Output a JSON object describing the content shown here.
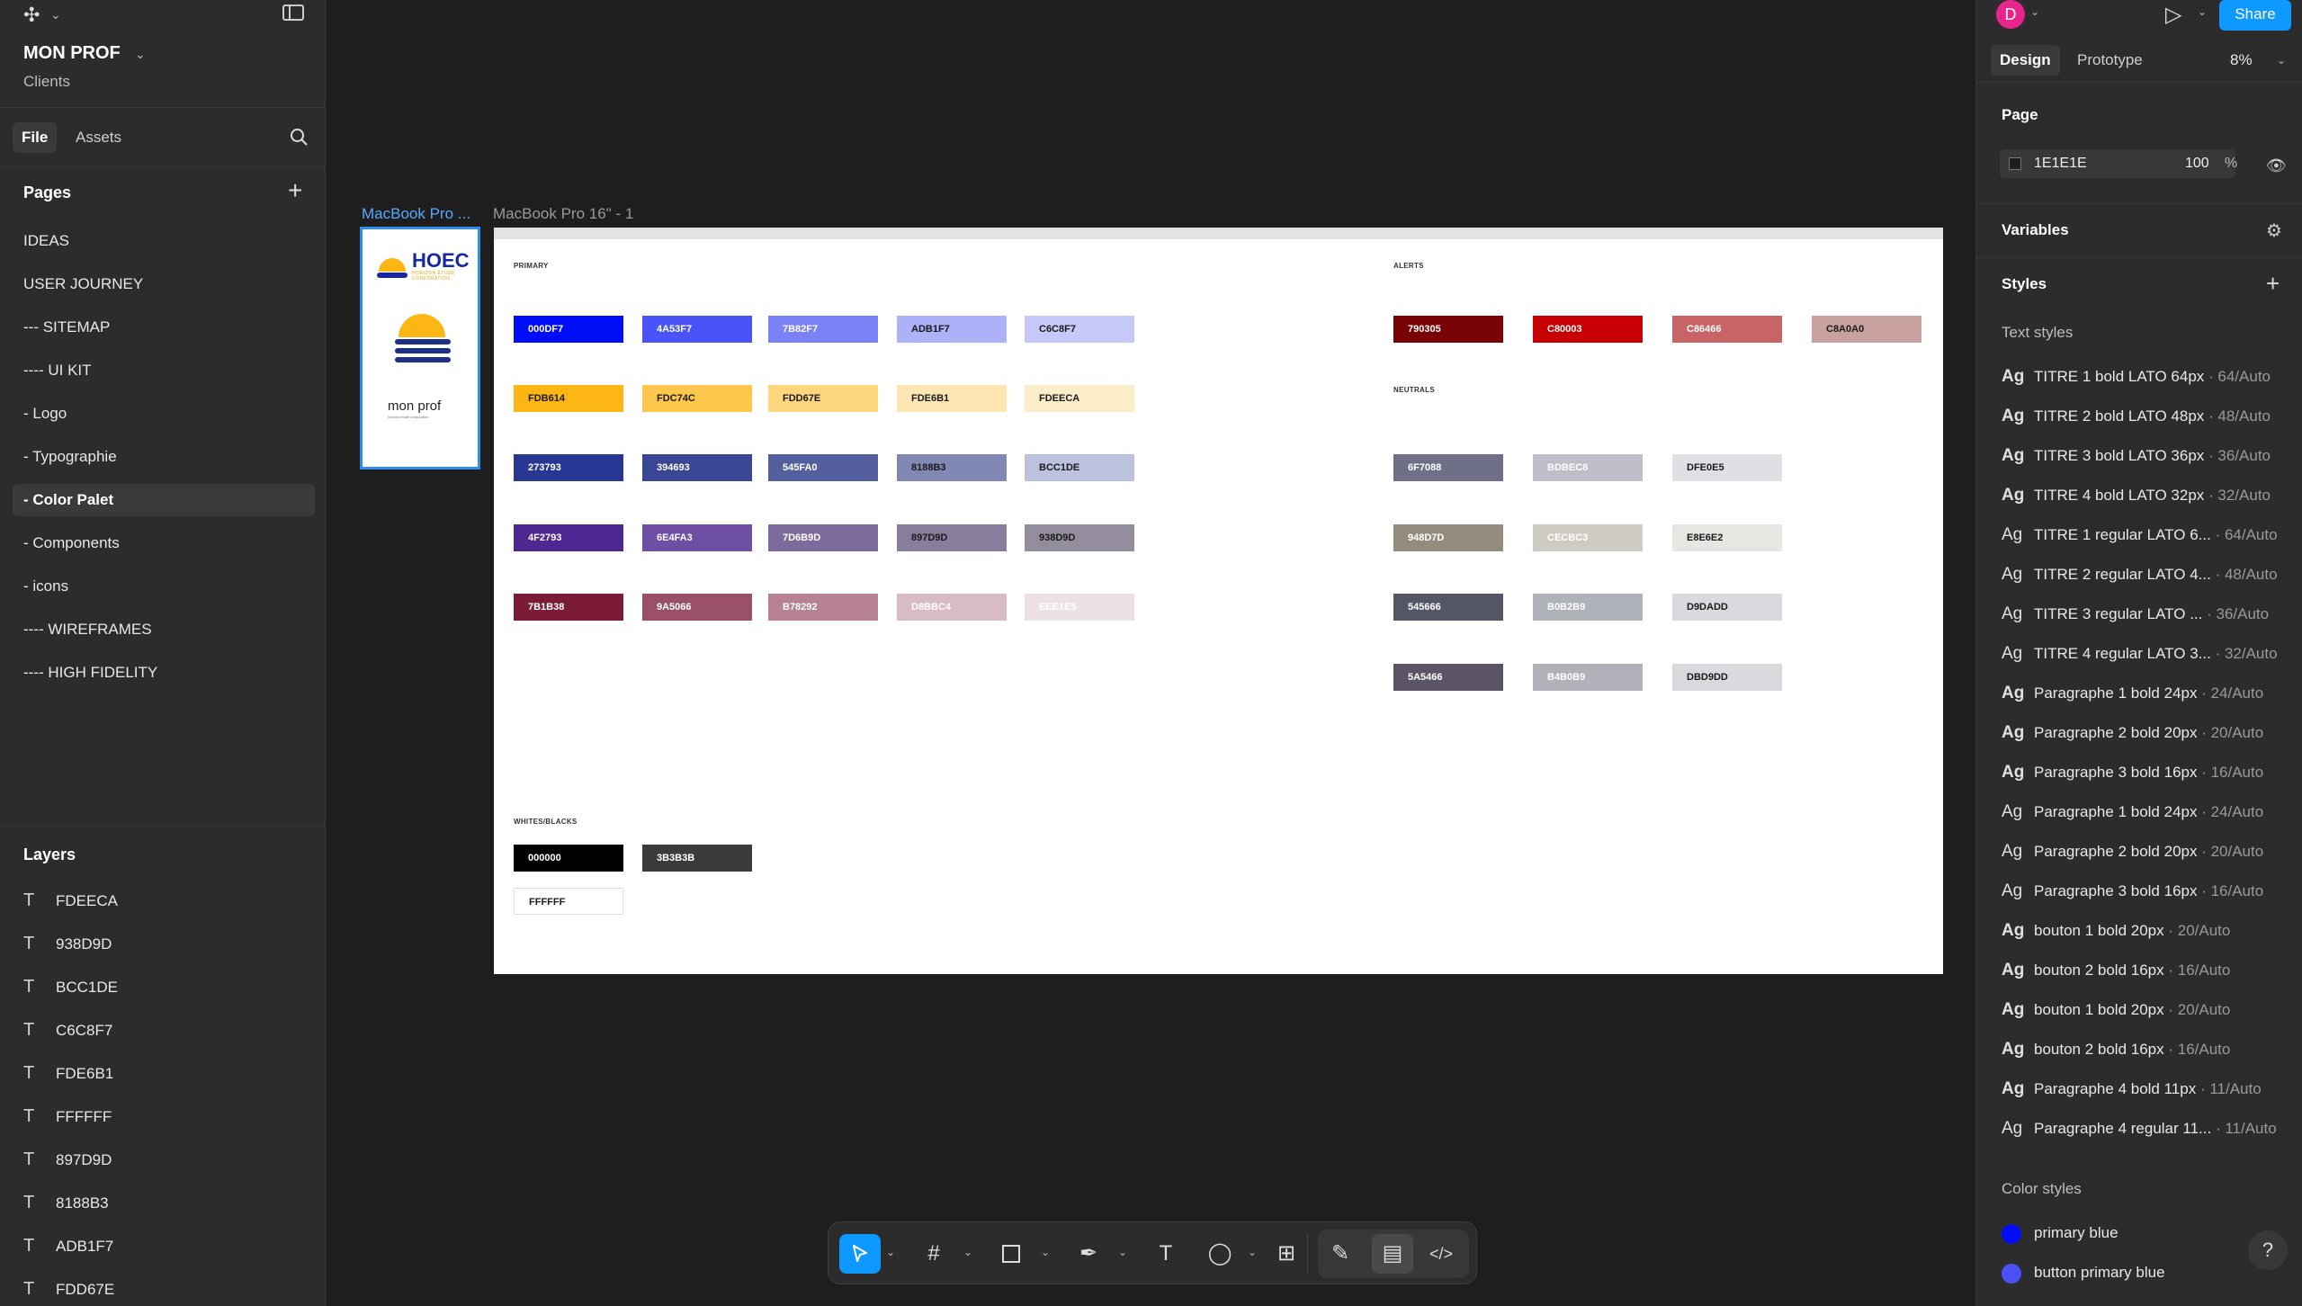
{
  "app": {
    "project_name": "MON PROF",
    "team": "Clients",
    "tabs": {
      "file": "File",
      "assets": "Assets"
    }
  },
  "pages": {
    "title": "Pages",
    "items": [
      "IDEAS",
      "USER JOURNEY",
      "--- SITEMAP",
      "---- UI KIT",
      "- Logo",
      "- Typographie",
      "- Color Palet",
      "- Components",
      "- icons",
      "---- WIREFRAMES",
      "---- HIGH FIDELITY"
    ],
    "active": "- Color Palet"
  },
  "layers": {
    "title": "Layers",
    "items": [
      "FDEECA",
      "938D9D",
      "BCC1DE",
      "C6C8F7",
      "FDE6B1",
      "FFFFFF",
      "897D9D",
      "8188B3",
      "ADB1F7",
      "FDD67E"
    ]
  },
  "canvas": {
    "frame_label_selected": "MacBook Pro ...",
    "frame_label_main": "MacBook Pro 16\" - 1",
    "thumb": {
      "logo_text": "HOEC",
      "logo_sub": "HORIZON ÉTUDE CORPORATION",
      "brand": "mon prof",
      "brand_sub": "horizon étude corporation"
    },
    "sections": {
      "primary": "PRIMARY",
      "alerts": "ALERTS",
      "neutrals": "NEUTRALS",
      "whites_blacks": "WHITES/BLACKS"
    },
    "primary_rows": [
      [
        {
          "hex": "000DF7",
          "bg": "#000DF7",
          "fg": "#ffffff"
        },
        {
          "hex": "4A53F7",
          "bg": "#4A53F7",
          "fg": "#ffffff"
        },
        {
          "hex": "7B82F7",
          "bg": "#7B82F7",
          "fg": "#ffffff"
        },
        {
          "hex": "ADB1F7",
          "bg": "#ADB1F7",
          "fg": "#1a1a1a"
        },
        {
          "hex": "C6C8F7",
          "bg": "#C6C8F7",
          "fg": "#1a1a1a"
        }
      ],
      [
        {
          "hex": "FDB614",
          "bg": "#FDB614",
          "fg": "#1a1a1a"
        },
        {
          "hex": "FDC74C",
          "bg": "#FDC74C",
          "fg": "#1a1a1a"
        },
        {
          "hex": "FDD67E",
          "bg": "#FDD67E",
          "fg": "#1a1a1a"
        },
        {
          "hex": "FDE6B1",
          "bg": "#FDE6B1",
          "fg": "#1a1a1a"
        },
        {
          "hex": "FDEECA",
          "bg": "#FDEECA",
          "fg": "#1a1a1a"
        }
      ],
      [
        {
          "hex": "273793",
          "bg": "#273793",
          "fg": "#ffffff"
        },
        {
          "hex": "394693",
          "bg": "#394693",
          "fg": "#ffffff"
        },
        {
          "hex": "545FA0",
          "bg": "#545FA0",
          "fg": "#ffffff"
        },
        {
          "hex": "8188B3",
          "bg": "#8188B3",
          "fg": "#1a1a1a"
        },
        {
          "hex": "BCC1DE",
          "bg": "#BCC1DE",
          "fg": "#1a1a1a"
        }
      ],
      [
        {
          "hex": "4F2793",
          "bg": "#4F2793",
          "fg": "#ffffff"
        },
        {
          "hex": "6E4FA3",
          "bg": "#6E4FA3",
          "fg": "#ffffff"
        },
        {
          "hex": "7D6B9D",
          "bg": "#7D6B9D",
          "fg": "#ffffff"
        },
        {
          "hex": "897D9D",
          "bg": "#897D9D",
          "fg": "#1a1a1a"
        },
        {
          "hex": "938D9D",
          "bg": "#938D9D",
          "fg": "#1a1a1a"
        }
      ],
      [
        {
          "hex": "7B1B38",
          "bg": "#7B1B38",
          "fg": "#ffffff"
        },
        {
          "hex": "9A5066",
          "bg": "#9A5066",
          "fg": "#ffffff"
        },
        {
          "hex": "B78292",
          "bg": "#B78292",
          "fg": "#ffffff"
        },
        {
          "hex": "D8BBC4",
          "bg": "#D8BBC4",
          "fg": "#ffffff"
        },
        {
          "hex": "EEE1E5",
          "bg": "#EEE1E5",
          "fg": "#ffffff"
        }
      ]
    ],
    "alerts": [
      {
        "hex": "790305",
        "bg": "#790305",
        "fg": "#ffffff"
      },
      {
        "hex": "C80003",
        "bg": "#C80003",
        "fg": "#ffffff"
      },
      {
        "hex": "C86466",
        "bg": "#C86466",
        "fg": "#ffffff"
      },
      {
        "hex": "C8A0A0",
        "bg": "#C8A0A0",
        "fg": "#1a1a1a"
      }
    ],
    "neutral_rows": [
      [
        {
          "hex": "6F7088",
          "bg": "#6F7088",
          "fg": "#ffffff"
        },
        {
          "hex": "BDBEC8",
          "bg": "#BDBEC8",
          "fg": "#ffffff"
        },
        {
          "hex": "DFE0E5",
          "bg": "#DFE0E5",
          "fg": "#1a1a1a"
        }
      ],
      [
        {
          "hex": "948D7D",
          "bg": "#948D7D",
          "fg": "#ffffff"
        },
        {
          "hex": "CECBC3",
          "bg": "#CECBC3",
          "fg": "#ffffff"
        },
        {
          "hex": "E8E6E2",
          "bg": "#E8E6E2",
          "fg": "#1a1a1a"
        }
      ],
      [
        {
          "hex": "545666",
          "bg": "#545666",
          "fg": "#ffffff"
        },
        {
          "hex": "B0B2B9",
          "bg": "#B0B2B9",
          "fg": "#ffffff"
        },
        {
          "hex": "D9DADD",
          "bg": "#D9DADD",
          "fg": "#1a1a1a"
        }
      ],
      [
        {
          "hex": "5A5466",
          "bg": "#5A5466",
          "fg": "#ffffff"
        },
        {
          "hex": "B4B0B9",
          "bg": "#B4B0B9",
          "fg": "#ffffff"
        },
        {
          "hex": "DBD9DD",
          "bg": "#DBD9DD",
          "fg": "#1a1a1a"
        }
      ]
    ],
    "whites_blacks": [
      {
        "hex": "000000",
        "bg": "#000000",
        "fg": "#ffffff"
      },
      {
        "hex": "3B3B3B",
        "bg": "#3B3B3B",
        "fg": "#ffffff"
      },
      {
        "hex": "FFFFFF",
        "bg": "#FFFFFF",
        "fg": "#1a1a1a"
      }
    ]
  },
  "toolbar": {
    "tools": [
      "move-tool",
      "frame-tool",
      "shape-tool",
      "pen-tool",
      "text-tool",
      "comment-tool",
      "actions-tool",
      "draw-mode",
      "design-mode",
      "dev-mode"
    ]
  },
  "right": {
    "avatar_initial": "D",
    "share_label": "Share",
    "tabs": {
      "design": "Design",
      "prototype": "Prototype"
    },
    "zoom": "8%",
    "page_title": "Page",
    "page_bg_hex": "1E1E1E",
    "page_bg_opacity": "100",
    "page_bg_pct": "%",
    "variables_title": "Variables",
    "styles_title": "Styles",
    "text_styles_title": "Text styles",
    "text_styles": [
      {
        "name": "TITRE 1 bold LATO 64px",
        "meta": "· 64/Auto",
        "bold": true
      },
      {
        "name": "TITRE 2 bold LATO 48px",
        "meta": "· 48/Auto",
        "bold": true
      },
      {
        "name": "TITRE 3 bold LATO 36px",
        "meta": "· 36/Auto",
        "bold": true
      },
      {
        "name": "TITRE 4 bold LATO 32px",
        "meta": "· 32/Auto",
        "bold": true
      },
      {
        "name": "TITRE 1 regular LATO 6...",
        "meta": "· 64/Auto",
        "bold": false
      },
      {
        "name": "TITRE 2 regular LATO 4...",
        "meta": "· 48/Auto",
        "bold": false
      },
      {
        "name": "TITRE 3 regular LATO ...",
        "meta": "· 36/Auto",
        "bold": false
      },
      {
        "name": "TITRE 4 regular LATO 3...",
        "meta": "· 32/Auto",
        "bold": false
      },
      {
        "name": "Paragraphe 1 bold 24px",
        "meta": "· 24/Auto",
        "bold": true
      },
      {
        "name": "Paragraphe 2 bold 20px",
        "meta": "· 20/Auto",
        "bold": true
      },
      {
        "name": "Paragraphe 3 bold 16px",
        "meta": "· 16/Auto",
        "bold": true
      },
      {
        "name": "Paragraphe 1 bold 24px",
        "meta": "· 24/Auto",
        "bold": false
      },
      {
        "name": "Paragraphe 2 bold 20px",
        "meta": "· 20/Auto",
        "bold": false
      },
      {
        "name": "Paragraphe 3 bold 16px",
        "meta": "· 16/Auto",
        "bold": false
      },
      {
        "name": "bouton 1 bold 20px",
        "meta": "· 20/Auto",
        "bold": true
      },
      {
        "name": "bouton 2 bold 16px",
        "meta": "· 16/Auto",
        "bold": true
      },
      {
        "name": "bouton 1 bold 20px",
        "meta": "· 20/Auto",
        "bold": true
      },
      {
        "name": "bouton 2 bold 16px",
        "meta": "· 16/Auto",
        "bold": true
      },
      {
        "name": "Paragraphe 4 bold 11px",
        "meta": "· 11/Auto",
        "bold": true
      },
      {
        "name": "Paragraphe 4 regular 11...",
        "meta": "· 11/Auto",
        "bold": false
      }
    ],
    "color_styles_title": "Color styles",
    "color_styles": [
      {
        "name": "primary blue",
        "color": "#000DF7"
      },
      {
        "name": "button primary blue",
        "color": "#4A53F7"
      }
    ],
    "help_label": "?"
  }
}
